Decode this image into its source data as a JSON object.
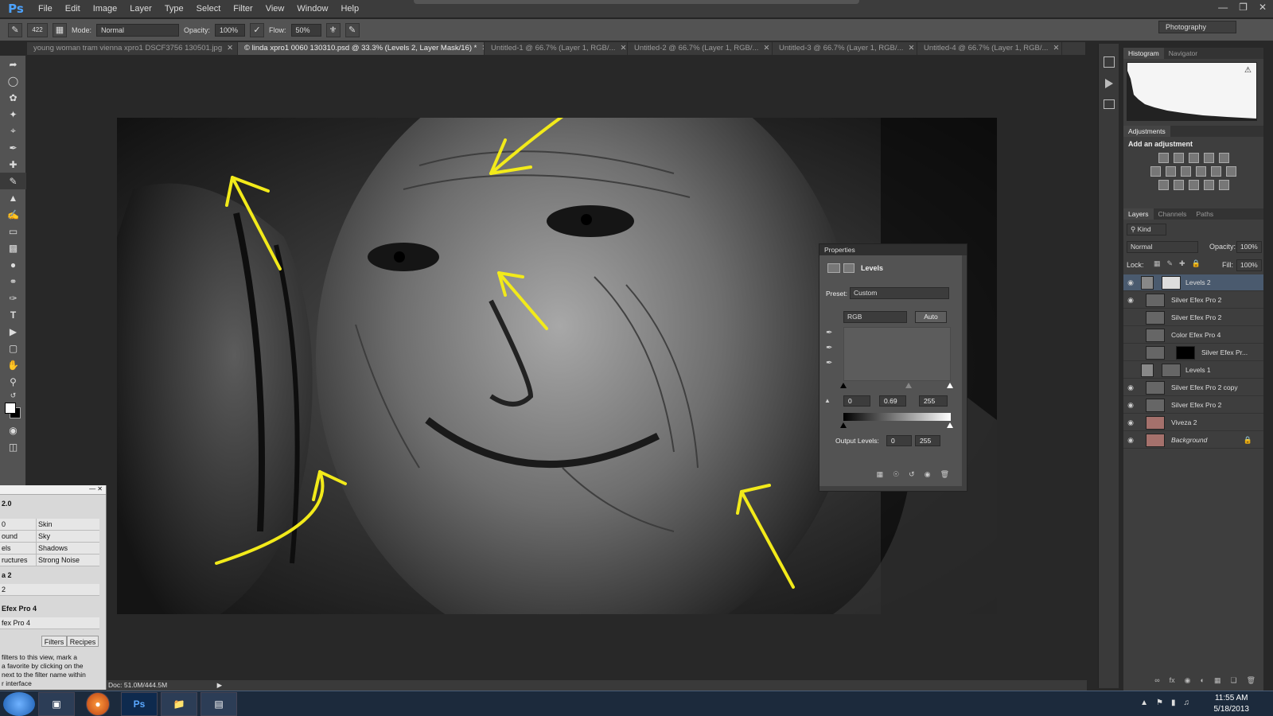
{
  "app": {
    "logo": "Ps"
  },
  "menu": [
    "File",
    "Edit",
    "Image",
    "Layer",
    "Type",
    "Select",
    "Filter",
    "View",
    "Window",
    "Help"
  ],
  "options": {
    "brush_size": "422",
    "mode_label": "Mode:",
    "mode_value": "Normal",
    "opacity_label": "Opacity:",
    "opacity_value": "100%",
    "flow_label": "Flow:",
    "flow_value": "50%",
    "workspace": "Photography"
  },
  "tabs": [
    {
      "label": "young woman tram vienna xpro1 DSCF3756 130501.jpg"
    },
    {
      "label": "© linda xpro1 0060 130310.psd @ 33.3% (Levels 2, Layer Mask/16) *"
    },
    {
      "label": "Untitled-1 @ 66.7% (Layer 1, RGB/..."
    },
    {
      "label": "Untitled-2 @ 66.7% (Layer 1, RGB/..."
    },
    {
      "label": "Untitled-3 @ 66.7% (Layer 1, RGB/..."
    },
    {
      "label": "Untitled-4 @ 66.7% (Layer 1, RGB/..."
    }
  ],
  "status": {
    "doc": "Doc: 51.0M/444.5M"
  },
  "histogram_tabs": [
    "Histogram",
    "Navigator"
  ],
  "adjustments": {
    "tab": "Adjustments",
    "title": "Add an adjustment"
  },
  "layers_tabs": [
    "Layers",
    "Channels",
    "Paths"
  ],
  "layers_controls": {
    "kind": "Kind",
    "blend": "Normal",
    "opacity_label": "Opacity:",
    "opacity": "100%",
    "lock_label": "Lock:",
    "fill_label": "Fill:",
    "fill": "100%"
  },
  "layers": [
    {
      "name": "Levels 2"
    },
    {
      "name": "Silver Efex Pro 2"
    },
    {
      "name": "Silver Efex Pro 2"
    },
    {
      "name": "Color Efex Pro 4"
    },
    {
      "name": "Silver Efex Pr..."
    },
    {
      "name": "Levels 1"
    },
    {
      "name": "Silver Efex Pro 2 copy"
    },
    {
      "name": "Silver Efex Pro 2"
    },
    {
      "name": "Viveza 2"
    },
    {
      "name": "Background"
    }
  ],
  "properties": {
    "title": "Properties",
    "adj_name": "Levels",
    "preset_label": "Preset:",
    "preset": "Custom",
    "channel": "RGB",
    "auto": "Auto",
    "input_black": "0",
    "input_gamma": "0.69",
    "input_white": "255",
    "output_label": "Output Levels:",
    "output_black": "0",
    "output_white": "255"
  },
  "leftpanel": {
    "version": "2.0",
    "rows": [
      {
        "a": "0",
        "b": "Skin"
      },
      {
        "a": "ound",
        "b": "Sky"
      },
      {
        "a": "els",
        "b": "Shadows"
      },
      {
        "a": "ructures",
        "b": "Strong Noise"
      }
    ],
    "section1": "a 2",
    "section1_value": "2",
    "section2": "Efex Pro 4",
    "section2_value": "fex Pro 4",
    "tab_filters": "Filters",
    "tab_recipes": "Recipes",
    "help_lines": [
      "filters to this view, mark a",
      "a favorite by clicking on the",
      "next to the filter name within",
      "r interface"
    ]
  },
  "taskbar": {
    "time": "11:55 AM",
    "date": "5/18/2013",
    "ps": "Ps"
  }
}
